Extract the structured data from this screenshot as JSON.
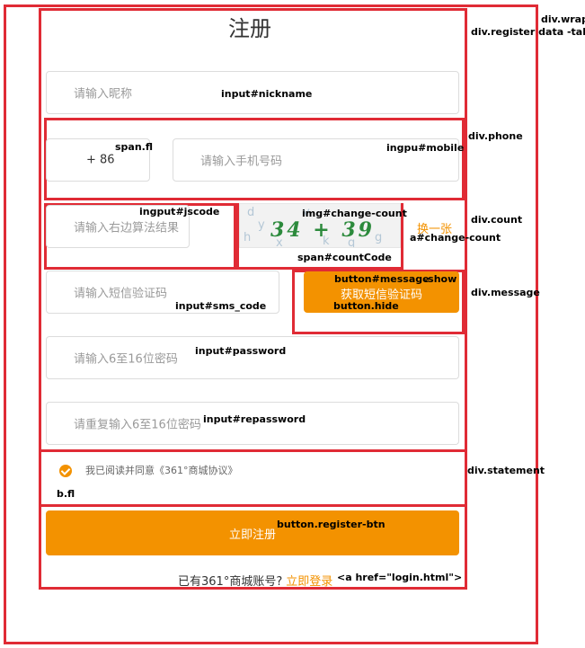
{
  "register": {
    "title": "注册",
    "nickname_placeholder": "请输入昵称",
    "country_code": "+ 86",
    "mobile_placeholder": "请输入手机号码",
    "jscode_placeholder": "请输入右边算法结果",
    "captcha_text": "34 + 39",
    "change_count_link": "换一张",
    "sms_placeholder": "请输入短信验证码",
    "sms_button": "获取短信验证码",
    "password_placeholder": "请输入6至16位密码",
    "repassword_placeholder": "请重复输入6至16位密码",
    "statement_text": "我已阅读并同意《361°商城协议》",
    "register_button": "立即注册",
    "login_prompt": "已有361°商城账号?",
    "login_link": "立即登录"
  },
  "annotations": {
    "wrap": "div.wrap",
    "register_table": "div.register data -table",
    "nickname": "input#nickname",
    "span_fl": "span.fl",
    "mobile": "ingpu#mobile",
    "phone": "div.phone",
    "jscode": "ingput#jscode",
    "img_change_count": "img#change-count",
    "count": "div.count",
    "a_change_count": "a#change-count",
    "span_count_code": "span#countCode",
    "button_message": "button#message",
    "show": ".show",
    "sms_code": "input#sms_code",
    "button_hide": "button.hide",
    "message": "div.message",
    "password": "input#password",
    "repassword": "input#repassword",
    "statement": "div.statement",
    "b_fl": "b.fl",
    "register_btn": "button.register-btn",
    "login_href": "<a href=\"login.html\">"
  },
  "colors": {
    "accent": "#f39200",
    "annotation_border": "#e02b35",
    "captcha_code": "#2c8a3c"
  }
}
